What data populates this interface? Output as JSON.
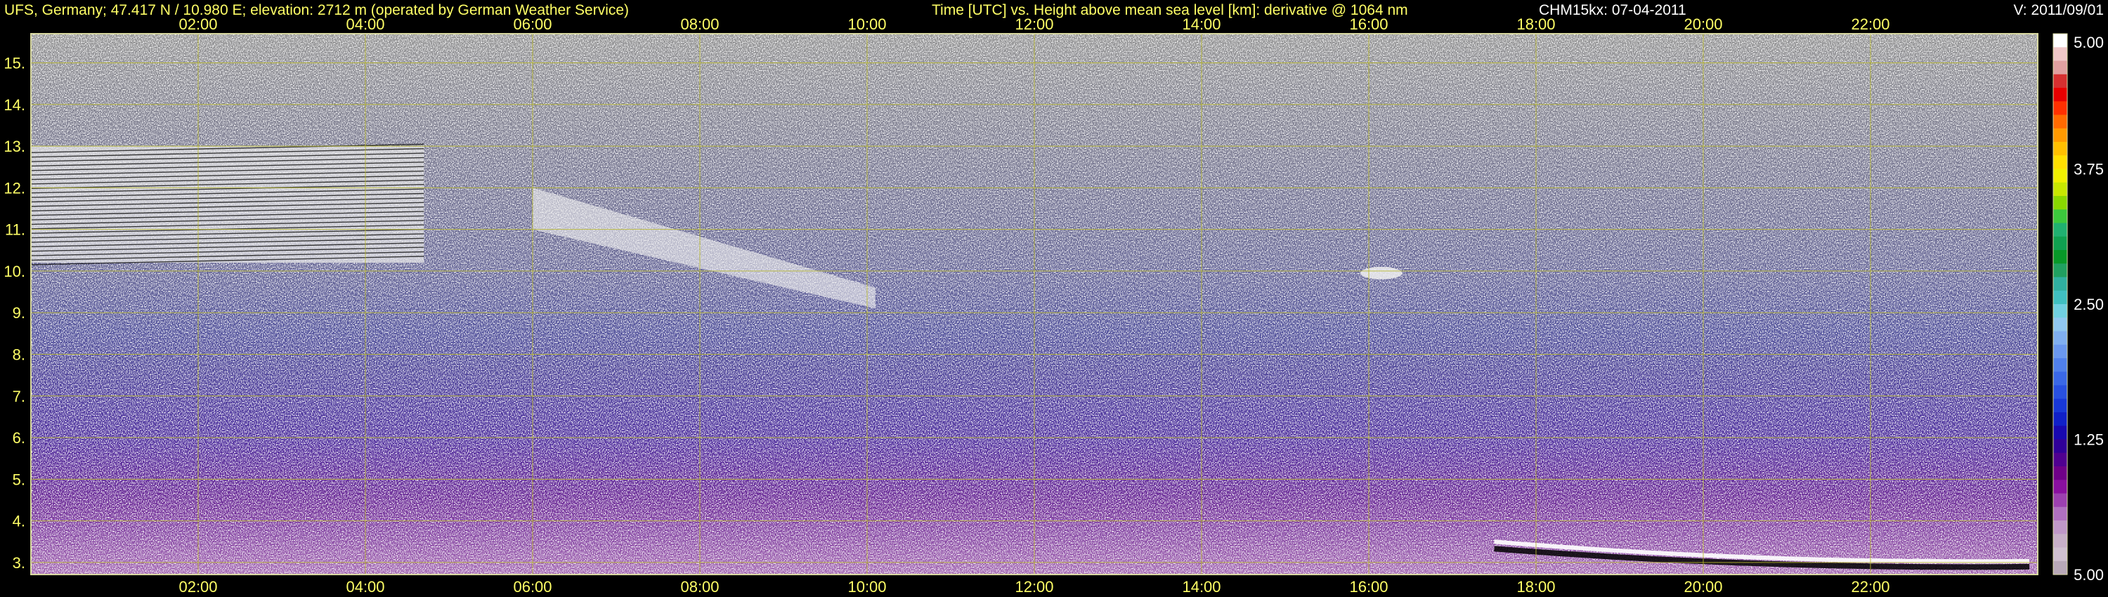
{
  "header": {
    "left": "UFS, Germany; 47.417 N / 10.980 E; elevation: 2712 m  (operated by German Weather Service)",
    "center": "Time [UTC] vs. Height above mean sea level [km]: derivative @ 1064 nm",
    "device": "CHM15kx: 07-04-2011",
    "version": "V: 2011/09/01"
  },
  "colors": {
    "background": "#000000",
    "text": "#ffff66",
    "grid": "#b8b82a",
    "frame": "#d8d8a0"
  },
  "chart_data": {
    "type": "heatmap",
    "xlabel": "Time [UTC]",
    "ylabel": "Height above mean sea level [km]",
    "xlim": [
      0.0,
      24.0
    ],
    "ylim": [
      2.712,
      15.7
    ],
    "x_ticks": [
      "02:00",
      "04:00",
      "06:00",
      "08:00",
      "10:00",
      "12:00",
      "14:00",
      "16:00",
      "18:00",
      "20:00",
      "22:00"
    ],
    "x_tick_values": [
      2,
      4,
      6,
      8,
      10,
      12,
      14,
      16,
      18,
      20,
      22
    ],
    "y_ticks": [
      "3.",
      "4.",
      "5.",
      "6.",
      "7.",
      "8.",
      "9.",
      "10.",
      "11.",
      "12.",
      "13.",
      "14.",
      "15."
    ],
    "y_tick_values": [
      3,
      4,
      5,
      6,
      7,
      8,
      9,
      10,
      11,
      12,
      13,
      14,
      15
    ],
    "grid": true,
    "colorbar": {
      "labels": [
        "5.00",
        "3.75",
        "2.50",
        "1.25",
        "5.00"
      ],
      "colors": [
        "#ffffff",
        "#f0c8c8",
        "#e0a0a0",
        "#d63030",
        "#e80000",
        "#ff3000",
        "#ff6a00",
        "#ff9a00",
        "#ffc000",
        "#ffe000",
        "#f0f000",
        "#c8e800",
        "#8ad800",
        "#3cc83c",
        "#20b070",
        "#10a050",
        "#089828",
        "#20a060",
        "#30b0a0",
        "#40c0c0",
        "#70d0e0",
        "#90c8f0",
        "#80b0f0",
        "#6a98ee",
        "#5080ea",
        "#3a68e6",
        "#2850e0",
        "#1838d8",
        "#1020c8",
        "#1808b0",
        "#300098",
        "#500090",
        "#700088",
        "#8a10a0",
        "#9c40b0",
        "#b070c0",
        "#c098c8",
        "#c8b0c8",
        "#d0c0d0",
        "#b8a8b8"
      ]
    },
    "features": [
      {
        "name": "upper cloud layer",
        "x_start": 0.0,
        "x_end": 4.7,
        "y_bottom": 10.2,
        "y_top": 13.0
      },
      {
        "name": "descending cloud band",
        "x_start": 6.0,
        "x_end": 10.1,
        "y_bottom": 8.4,
        "y_top": 12.0
      },
      {
        "name": "small cloud patch",
        "x_start": 15.9,
        "x_end": 16.4,
        "y_bottom": 9.8,
        "y_top": 10.1
      },
      {
        "name": "boundary layer top",
        "x_start": 17.5,
        "x_end": 23.9,
        "y_bottom": 2.9,
        "y_top": 3.5
      }
    ]
  }
}
